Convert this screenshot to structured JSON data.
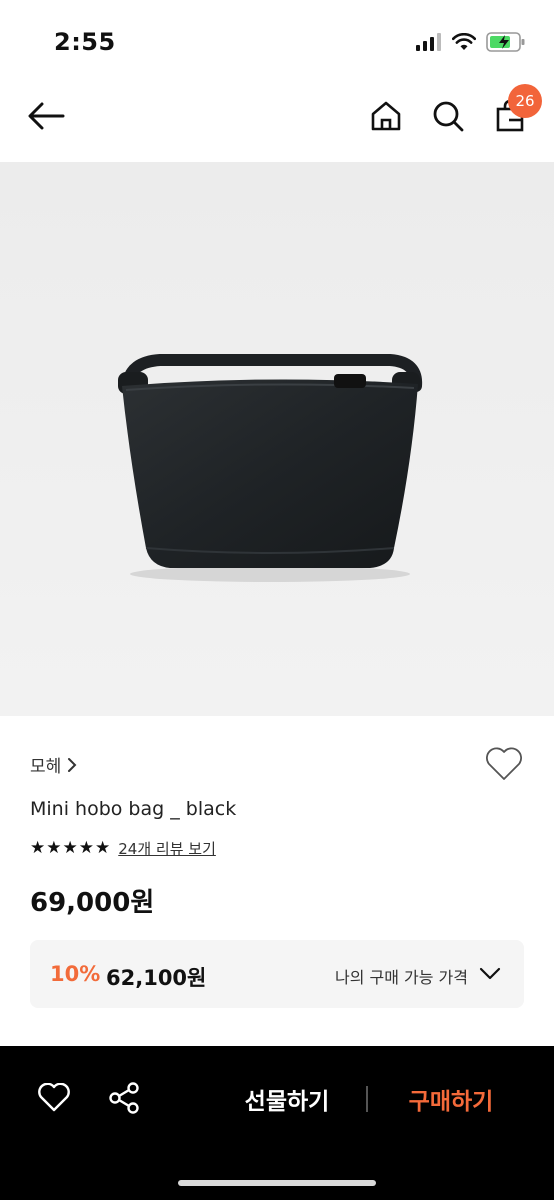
{
  "status_bar": {
    "time": "2:55"
  },
  "header": {
    "cart_count": "26"
  },
  "product": {
    "brand": "모헤",
    "name": "Mini hobo bag _ black",
    "review_link": "24개 리뷰 보기",
    "rating_stars": 5,
    "price": "69,000원"
  },
  "my_price": {
    "discount_rate": "10%",
    "discount_price": "62,100원",
    "label": "나의 구매 가능 가격"
  },
  "bottom_bar": {
    "gift_label": "선물하기",
    "buy_label": "구매하기"
  },
  "colors": {
    "accent": "#f2643a",
    "buy": "#f46a3a",
    "image_bg": "#efefef"
  },
  "icons": [
    "back-arrow-icon",
    "home-icon",
    "search-icon",
    "shopping-bag-icon",
    "heart-icon",
    "share-icon",
    "chevron-down-icon"
  ]
}
